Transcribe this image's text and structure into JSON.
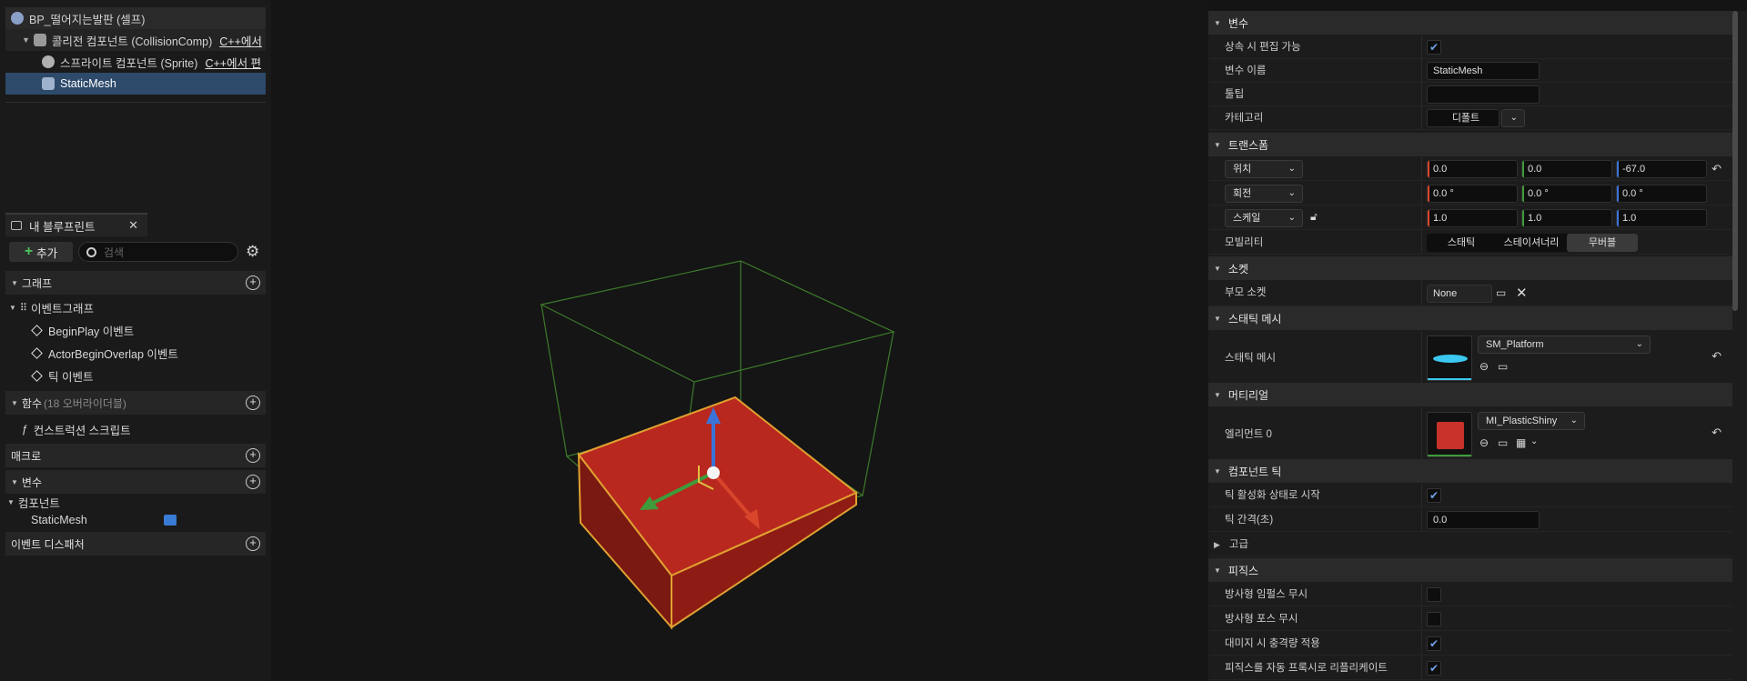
{
  "components_tree": {
    "root": "BP_떨어지는발판 (셀프)",
    "collision": "콜리전 컴포넌트 (CollisionComp)",
    "collision_cpp": "C++에서",
    "sprite": "스프라이트 컴포넌트 (Sprite)",
    "sprite_cpp": "C++에서 편",
    "static_mesh": "StaticMesh"
  },
  "my_blueprint": {
    "tab_title": "내 블루프린트",
    "add_label": "추가",
    "search_placeholder": "검색",
    "graphs_label": "그래프",
    "event_graph_label": "이벤트그래프",
    "events": [
      "BeginPlay 이벤트",
      "ActorBeginOverlap 이벤트",
      "틱 이벤트"
    ],
    "functions_label": "함수",
    "functions_sub": "(18 오버라이더블)",
    "construction_script": "컨스트럭션 스크립트",
    "macros_label": "매크로",
    "variables_label": "변수",
    "components_label": "컴포넌트",
    "component_item": "StaticMesh",
    "event_dispatchers_label": "이벤트 디스패처"
  },
  "details": {
    "variable_section": "변수",
    "editable_when_inherited": "상속 시 편집 가능",
    "editable_checked": true,
    "variable_name_label": "변수 이름",
    "variable_name_value": "StaticMesh",
    "tooltip_label": "툴팁",
    "category_label": "카테고리",
    "category_value": "디폴트",
    "transform_section": "트랜스폼",
    "location_label": "위치",
    "location": [
      "0.0",
      "0.0",
      "-67.0"
    ],
    "rotation_label": "회전",
    "rotation": [
      "0.0 °",
      "0.0 °",
      "0.0 °"
    ],
    "scale_label": "스케일",
    "scale": [
      "1.0",
      "1.0",
      "1.0"
    ],
    "mobility_label": "모빌리티",
    "mobility_options": [
      "스태틱",
      "스테이셔너리",
      "무버블"
    ],
    "mobility_selected": "무버블",
    "socket_section": "소켓",
    "parent_socket_label": "부모 소켓",
    "parent_socket_value": "None",
    "static_mesh_section": "스태틱 메시",
    "static_mesh_label": "스태틱 메시",
    "static_mesh_value": "SM_Platform",
    "material_section": "머티리얼",
    "element0_label": "엘리먼트 0",
    "material_value": "MI_PlasticShiny",
    "material_color": "#c8322a",
    "component_tick_section": "컴포넌트 틱",
    "start_tick_enabled_label": "틱 활성화 상태로 시작",
    "start_tick_enabled_checked": true,
    "tick_interval_label": "틱 간격(초)",
    "tick_interval_value": "0.0",
    "advanced_label": "고급",
    "physics_section": "피직스",
    "ignore_radial_impulse": "방사형 임펄스 무시",
    "ignore_radial_force": "방사형 포스 무시",
    "apply_impulse_on_damage": "대미지 시 충격량 적용",
    "replicate_physics": "피직스를 자동 프록시로 리플리케이트",
    "ignore_radial_impulse_checked": false,
    "ignore_radial_force_checked": false,
    "apply_impulse_on_damage_checked": true,
    "replicate_physics_checked": true
  },
  "colors": {
    "selection": "#2d4a6b",
    "platform_red": "#b8281f",
    "bounds_green": "#3d7a2a",
    "axis_x": "#d9452b",
    "axis_y": "#3f9b3a",
    "axis_z": "#3b73d9"
  }
}
